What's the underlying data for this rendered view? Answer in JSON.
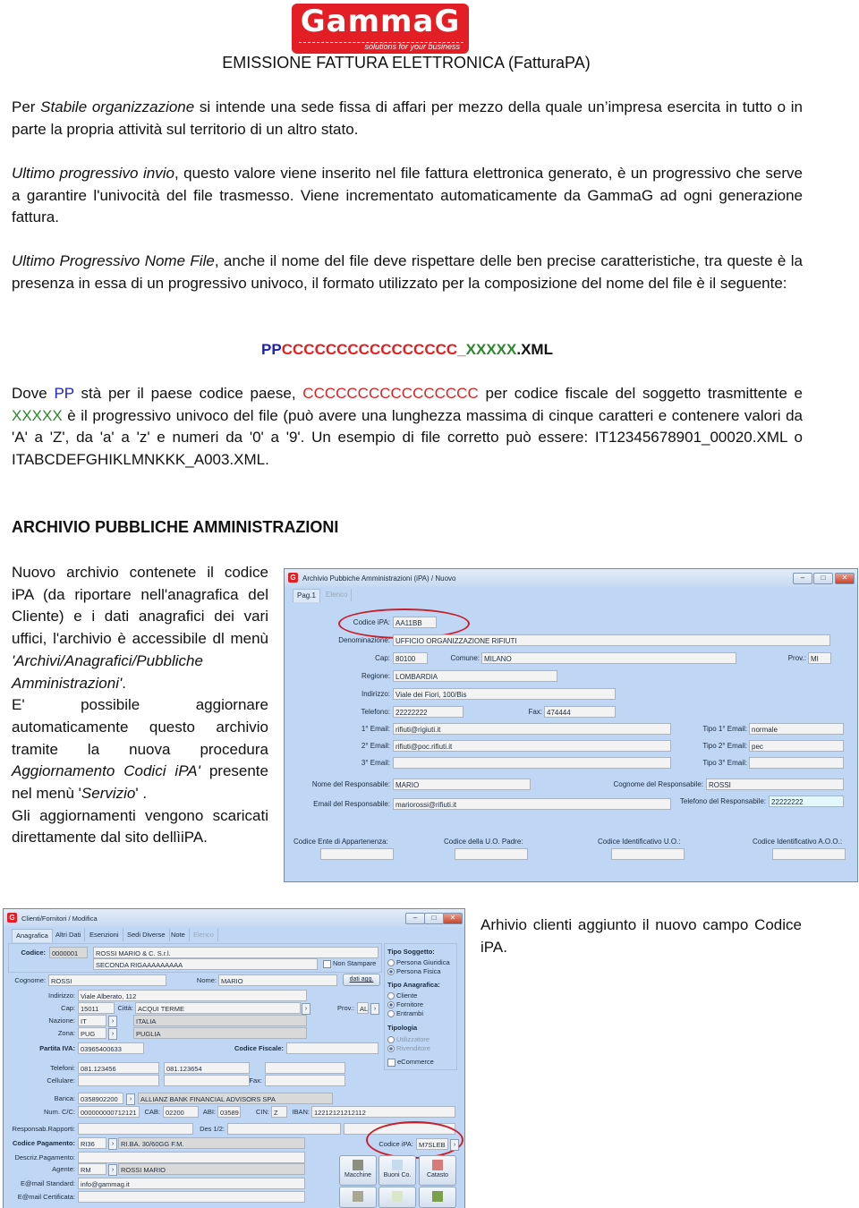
{
  "logo": {
    "brand": "GammaG",
    "tagline": "solutions for your business",
    "color": "#e31e24"
  },
  "title": "EMISSIONE FATTURA ELETTRONICA (FatturaPA)",
  "para1": {
    "a": "Per ",
    "b": "Stabile organizzazione",
    "c": " si intende una sede fissa di affari per mezzo della quale un’impresa esercita in tutto o in parte la propria attività sul territorio di un altro stato."
  },
  "para2": {
    "a": "Ultimo progressivo invio",
    "b": ", questo valore viene inserito nel file fattura elettronica generato, è un progressivo che serve a garantire l'univocità del file trasmesso. Viene incrementato automaticamente da GammaG ad ogni generazione fattura."
  },
  "para3": {
    "a": "Ultimo Progressivo Nome File",
    "b": ", anche il nome del file deve rispettare delle ben precise caratteristiche, tra queste è la presenza in essa di un progressivo univoco, il formato utilizzato per la composizione del nome del file è il seguente:"
  },
  "filename": {
    "pp": "PP",
    "cc": "CCCCCCCCCCCCCCCC",
    "sep": "_",
    "xx": "XXXXX",
    "ext": ".XML",
    "colors": {
      "pp": "#1f1fb0",
      "cc": "#e02020",
      "xx": "#2a8a2a"
    }
  },
  "para4": {
    "a": "Dove ",
    "pp": "PP",
    "b": " stà per il paese codice paese, ",
    "cc": "CCCCCCCCCCCCCCCC",
    "c": " per codice fiscale del soggetto trasmittente e ",
    "xx": "XXXXX",
    "d": " è il progressivo univoco del file (può avere una lunghezza massima di cinque caratteri e contenere valori da 'A' a 'Z', da 'a' a 'z' e numeri da '0' a '9'. Un esempio di file corretto può essere: IT12345678901_00020.XML o ITABCDEFGHIKLMNKKK_A003.XML."
  },
  "section_heading": "ARCHIVIO PUBBLICHE AMMINISTRAZIONI",
  "left_text": {
    "a": "Nuovo archivio contenete il codice iPA (da riportare nell'anagrafica del Cliente) e i dati anagrafici dei vari uffici, l'archivio è accessibile dl menù ",
    "b": "'Archivi/Anagrafici/Pubbliche Amministrazioni'",
    "c": ".",
    "d": "E' possibile aggiornare automaticamente questo archivio tramite la nuova procedura ",
    "e": "Aggiornamento Codici iPA'",
    "f": " presente nel menù '",
    "g": "Servizio",
    "h": "' .",
    "i": "Gli aggiornamenti vengono scaricati direttamente dal sito dellìiPA."
  },
  "right_text": "Arhivio clienti aggiunto il nuovo campo Codice iPA.",
  "win_ipa": {
    "title": "Archivio Pubbiche Amministrazioni (iPA) / Nuovo",
    "tabs": [
      "Pag.1",
      "Elenco"
    ],
    "labels": {
      "codice": "Codice iPA:",
      "denom": "Denominazione:",
      "cap": "Cap:",
      "comune": "Comune:",
      "prov": "Prov.:",
      "regione": "Regione:",
      "indirizzo": "Indirizzo:",
      "telefono": "Telefono:",
      "fax": "Fax:",
      "email1": "1° Email:",
      "email2": "2° Email:",
      "email3": "3° Email:",
      "tipo1": "Tipo 1° Email:",
      "tipo2": "Tipo 2° Email:",
      "tipo3": "Tipo 3° Email:",
      "nome_resp": "Nome del Responsabile:",
      "cognome_resp": "Cognome del Responsabile:",
      "email_resp": "Email del Responsabile:",
      "tel_resp": "Telefono del Responsabile:",
      "ente": "Codice Ente di Appartenenza:",
      "uo_padre": "Codice della U.O. Padre:",
      "id_uo": "Codice Identificativo U.O.:",
      "id_aoo": "Codice Identificativo A.O.O.:"
    },
    "values": {
      "codice": "AA11BB",
      "denom": "UFFICIO ORGANIZZAZIONE RIFIUTI",
      "cap": "80100",
      "comune": "MILANO",
      "prov": "MI",
      "regione": "LOMBARDIA",
      "indirizzo": "Viale dei Fiori, 100/Bis",
      "telefono": "22222222",
      "fax": "474444",
      "email1": "rifiuti@rigiuti.it",
      "email2": "rifiuti@poc.rifiuti.it",
      "email3": "",
      "tipo1": "normale",
      "tipo2": "pec",
      "tipo3": "",
      "nome_resp": "MARIO",
      "cognome_resp": "ROSSI",
      "email_resp": "mariorossi@rifiuti.it",
      "tel_resp": "22222222"
    }
  },
  "win_cli": {
    "title": "Clienti/Fornitori / Modifica",
    "tabs": [
      "Anagrafica",
      "Altri Dati",
      "Esenzioni",
      "Sedi Diverse",
      "Note",
      "Elenco"
    ],
    "labels": {
      "codice": "Codice:",
      "non_stampare": "Non Stampare",
      "cognome": "Cognome:",
      "nome": "Nome:",
      "dati_agg": "dati agg.",
      "indirizzo": "Indirizzo:",
      "cap": "Cap:",
      "citta": "Città:",
      "prov": "Prov.:",
      "nazione": "Nazione:",
      "zona": "Zona:",
      "piva": "Partita IVA:",
      "cf": "Codice Fiscale:",
      "telefoni": "Telefoni:",
      "cellulare": "Cellulare:",
      "fax": "Fax:",
      "banca": "Banca:",
      "numcc": "Num. C/C:",
      "cab": "CAB:",
      "abi": "ABI:",
      "cin": "CIN:",
      "iban": "IBAN:",
      "resp": "Responsab.Rapporti:",
      "des": "Des 1/2:",
      "cod_pag": "Codice Pagamento:",
      "descr_pag": "Descriz.Pagamento:",
      "agente": "Agente:",
      "email_std": "E@mail Standard:",
      "email_cert": "E@mail Certificata:",
      "codice_ipa": "Codice iPA:"
    },
    "values": {
      "codice": "0000001",
      "ragione1": "ROSSI MARIO & C. S.r.l.",
      "ragione2": "SECONDA RIGAAAAAAAAA",
      "cognome": "ROSSI",
      "nome": "MARIO",
      "indirizzo": "Viale Alberato, 112",
      "cap": "15011",
      "citta": "ACQUI TERME",
      "prov": "AL",
      "nazione": "IT",
      "nazione_desc": "ITALIA",
      "zona": "PUG",
      "zona_desc": "PUGLIA",
      "piva": "03965400633",
      "cf": "",
      "tel1": "081.123456",
      "tel2": "081.123654",
      "banca": "0358902200",
      "banca_desc": "ALLIANZ BANK FINANCIAL ADVISORS SPA",
      "numcc": "000000000712121",
      "cab": "02200",
      "abi": "03589",
      "cin": "Z",
      "iban": "12212121212112",
      "cod_pag": "RI36",
      "cod_pag_desc": "RI.BA. 30/60GG F.M.",
      "agente": "RM",
      "agente_desc": "ROSSI MARIO",
      "email_std": "info@gammag.it",
      "codice_ipa": "M7SLEB"
    },
    "tipo_soggetto": {
      "title": "Tipo Soggetto:",
      "options": [
        "Persona Giuridica",
        "Persona Fisica"
      ],
      "selected": "Persona Fisica"
    },
    "tipo_anagrafica": {
      "title": "Tipo Anagrafica:",
      "options": [
        "Cliente",
        "Fornitore",
        "Entrambi"
      ],
      "selected": "Fornitore"
    },
    "tipologia": {
      "title": "Tipologia",
      "options": [
        "Utilizzatore",
        "Rivenditore"
      ],
      "selected": "Rivenditore"
    },
    "ecommerce": "eCommerce",
    "buttons": [
      "Macchine",
      "Buoni Co.",
      "Catasto"
    ]
  }
}
